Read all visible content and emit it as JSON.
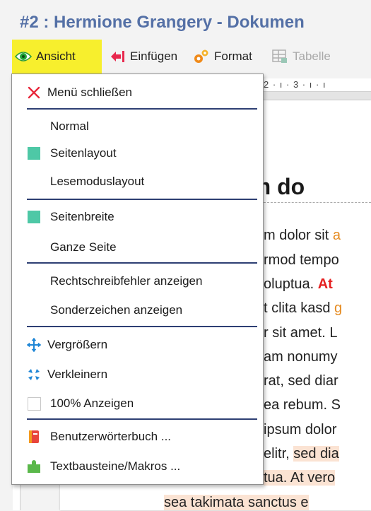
{
  "window": {
    "title": "#2 : Hermione Grangery - Dokumen"
  },
  "toolbar": {
    "items": [
      {
        "label": "Ansicht",
        "icon": "eye-icon",
        "highlight": "#f7ef2d"
      },
      {
        "label": "Einfügen",
        "icon": "arrow-left-icon"
      },
      {
        "label": "Format",
        "icon": "gears-icon"
      },
      {
        "label": "Tabelle",
        "icon": "table-icon",
        "disabled": true
      }
    ]
  },
  "ruler": {
    "text": "2 · ı · 3 · ı · ı"
  },
  "document": {
    "heading": "ipsum do",
    "lines": [
      {
        "parts": [
          {
            "text": "m dolor sit "
          },
          {
            "text": "a",
            "style": "orange"
          }
        ]
      },
      {
        "parts": [
          {
            "text": "rmod tempo"
          }
        ]
      },
      {
        "parts": [
          {
            "text": "oluptua. "
          },
          {
            "text": "At",
            "style": "red"
          }
        ]
      },
      {
        "parts": [
          {
            "text": "t clita kasd "
          },
          {
            "text": "g",
            "style": "orange"
          }
        ]
      },
      {
        "parts": [
          {
            "text": "r sit amet. L"
          }
        ]
      },
      {
        "parts": [
          {
            "text": "am nonumy"
          }
        ]
      },
      {
        "parts": [
          {
            "text": "rat, sed diar"
          }
        ]
      },
      {
        "parts": [
          {
            "text": "ea rebum. S"
          }
        ]
      },
      {
        "parts": [
          {
            "text": "ipsum dolor"
          }
        ]
      },
      {
        "parts": [
          {
            "text": "elitr, "
          },
          {
            "text": "sed dia",
            "style": "hl"
          }
        ]
      },
      {
        "parts": [
          {
            "text": "tua. At vero",
            "style": "hl"
          }
        ]
      },
      {
        "parts": [
          {
            "text": "sea takimata sanctus e",
            "style": "hl"
          }
        ]
      }
    ],
    "left_ruler_marks": "8\n-"
  },
  "menu": {
    "items": [
      {
        "label": "Menü schließen",
        "icon": "close-icon",
        "name": "menu-item-close"
      },
      {
        "separator": true
      },
      {
        "label": "Normal",
        "icon": "none",
        "name": "menu-item-normal"
      },
      {
        "label": "Seitenlayout",
        "icon": "checked-square-icon",
        "name": "menu-item-seitenlayout"
      },
      {
        "label": "Lesemoduslayout",
        "icon": "none",
        "name": "menu-item-lesemoduslayout"
      },
      {
        "separator": true
      },
      {
        "label": "Seitenbreite",
        "icon": "checked-square-icon",
        "name": "menu-item-seitenbreite"
      },
      {
        "label": "Ganze Seite",
        "icon": "none",
        "name": "menu-item-ganze-seite"
      },
      {
        "separator": true
      },
      {
        "label": "Rechtschreibfehler anzeigen",
        "icon": "none",
        "name": "menu-item-rechtschreibfehler"
      },
      {
        "label": "Sonderzeichen anzeigen",
        "icon": "none",
        "name": "menu-item-sonderzeichen"
      },
      {
        "separator": true
      },
      {
        "label": "Vergrößern",
        "icon": "zoom-in-arrows-icon",
        "name": "menu-item-vergroessern"
      },
      {
        "label": "Verkleinern",
        "icon": "zoom-out-arrows-icon",
        "name": "menu-item-verkleinern"
      },
      {
        "label": "100% Anzeigen",
        "icon": "unchecked-square-icon",
        "name": "menu-item-100-anzeigen"
      },
      {
        "separator": true
      },
      {
        "label": "Benutzerwörterbuch ...",
        "icon": "book-icon",
        "name": "menu-item-benutzerwoerterbuch"
      },
      {
        "label": "Textbausteine/Makros ...",
        "icon": "puzzle-icon",
        "name": "menu-item-textbausteine"
      }
    ]
  }
}
